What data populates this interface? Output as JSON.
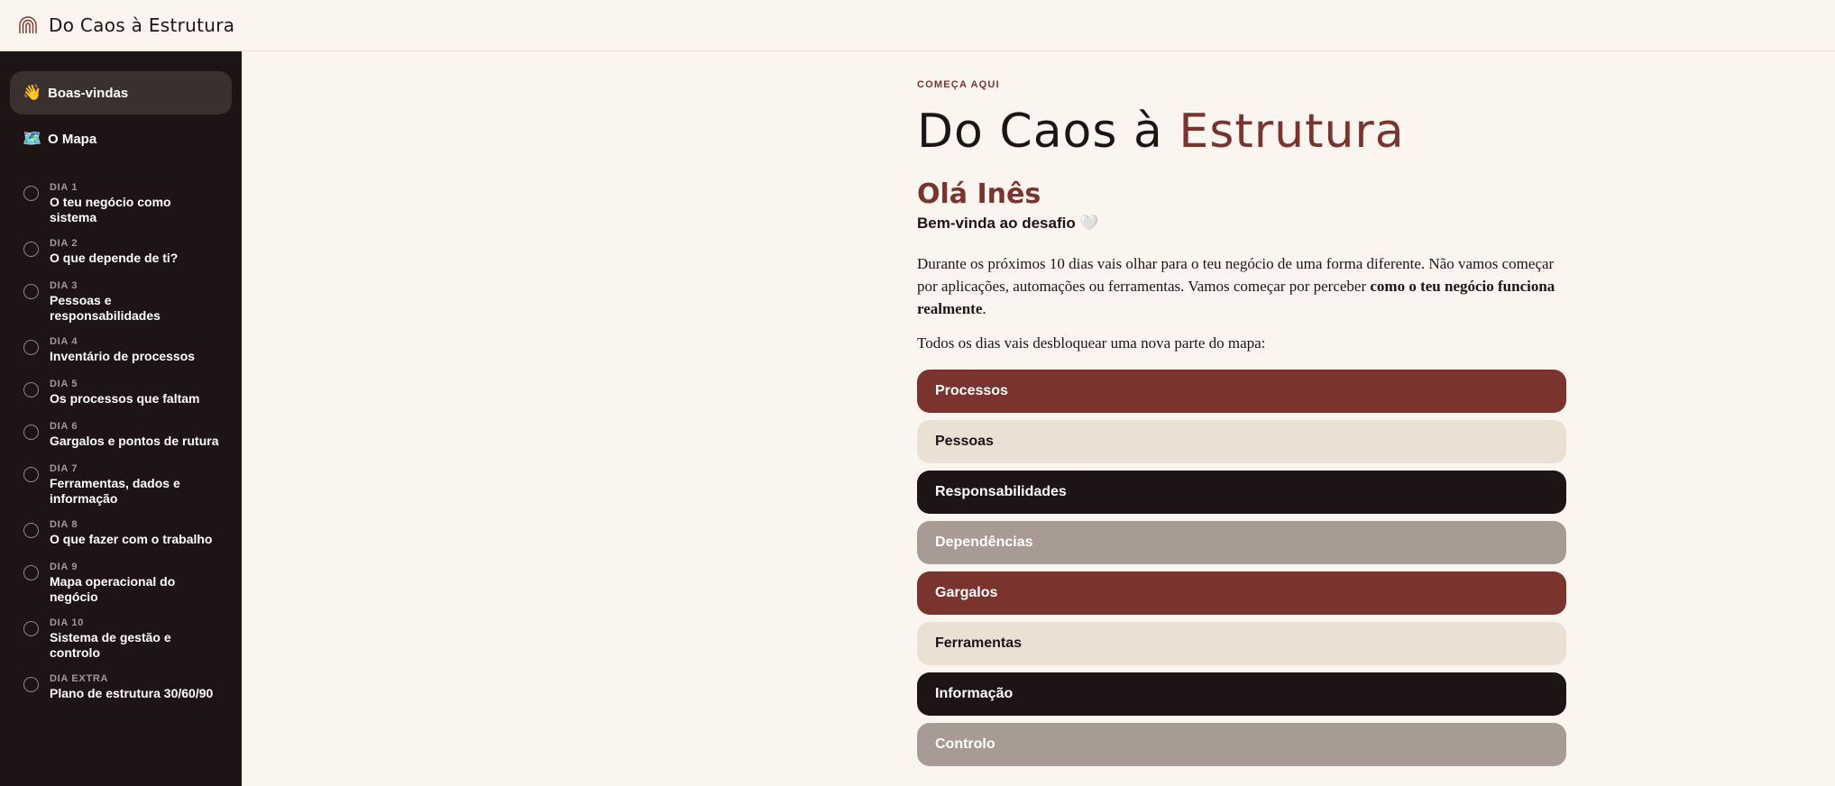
{
  "header": {
    "brand": "Do Caos à Estrutura",
    "logo_icon": "rainbow-arch-icon"
  },
  "sidebar": {
    "top_items": [
      {
        "emoji": "👋",
        "label": "Boas-vindas",
        "active": true
      },
      {
        "emoji": "🗺️",
        "label": "O Mapa",
        "active": false
      }
    ],
    "days": [
      {
        "day": "DIA 1",
        "title": "O teu negócio como sistema"
      },
      {
        "day": "DIA 2",
        "title": "O que depende de ti?"
      },
      {
        "day": "DIA 3",
        "title": "Pessoas e responsabilidades"
      },
      {
        "day": "DIA 4",
        "title": "Inventário de processos"
      },
      {
        "day": "DIA 5",
        "title": "Os processos que faltam"
      },
      {
        "day": "DIA 6",
        "title": "Gargalos e pontos de rutura"
      },
      {
        "day": "DIA 7",
        "title": "Ferramentas, dados e informação"
      },
      {
        "day": "DIA 8",
        "title": "O que fazer com o trabalho"
      },
      {
        "day": "DIA 9",
        "title": "Mapa operacional do negócio"
      },
      {
        "day": "DIA 10",
        "title": "Sistema de gestão e controlo"
      },
      {
        "day": "DIA EXTRA",
        "title": "Plano de estrutura 30/60/90"
      }
    ]
  },
  "main": {
    "eyebrow": "COMEÇA AQUI",
    "title_part1": "Do Caos à ",
    "title_part2": "Estrutura",
    "greeting": "Olá Inês",
    "welcome": "Bem-vinda ao desafio 🤍",
    "intro_part1": "Durante os próximos 10 dias vais olhar para o teu negócio de uma forma diferente. Não vamos começar por aplicações, automações ou ferramentas. Vamos começar por perceber ",
    "intro_bold": "como o teu negócio funciona realmente",
    "intro_end": ".",
    "intro2": "Todos os dias vais desbloquear uma nova parte do mapa:",
    "pills": [
      {
        "label": "Processos",
        "bg": "#7a332d",
        "fg": "#ffffff"
      },
      {
        "label": "Pessoas",
        "bg": "#eae0d4",
        "fg": "#1e1416"
      },
      {
        "label": "Responsabilidades",
        "bg": "#1e1416",
        "fg": "#ffffff"
      },
      {
        "label": "Dependências",
        "bg": "#a79b94",
        "fg": "#ffffff"
      },
      {
        "label": "Gargalos",
        "bg": "#7a332d",
        "fg": "#ffffff"
      },
      {
        "label": "Ferramentas",
        "bg": "#eae0d4",
        "fg": "#1e1416"
      },
      {
        "label": "Informação",
        "bg": "#1e1416",
        "fg": "#ffffff"
      },
      {
        "label": "Controlo",
        "bg": "#a79b94",
        "fg": "#ffffff"
      }
    ]
  },
  "colors": {
    "accent": "#7a332d",
    "sidebar_bg": "#1e1416",
    "page_bg": "#faf5ef"
  }
}
